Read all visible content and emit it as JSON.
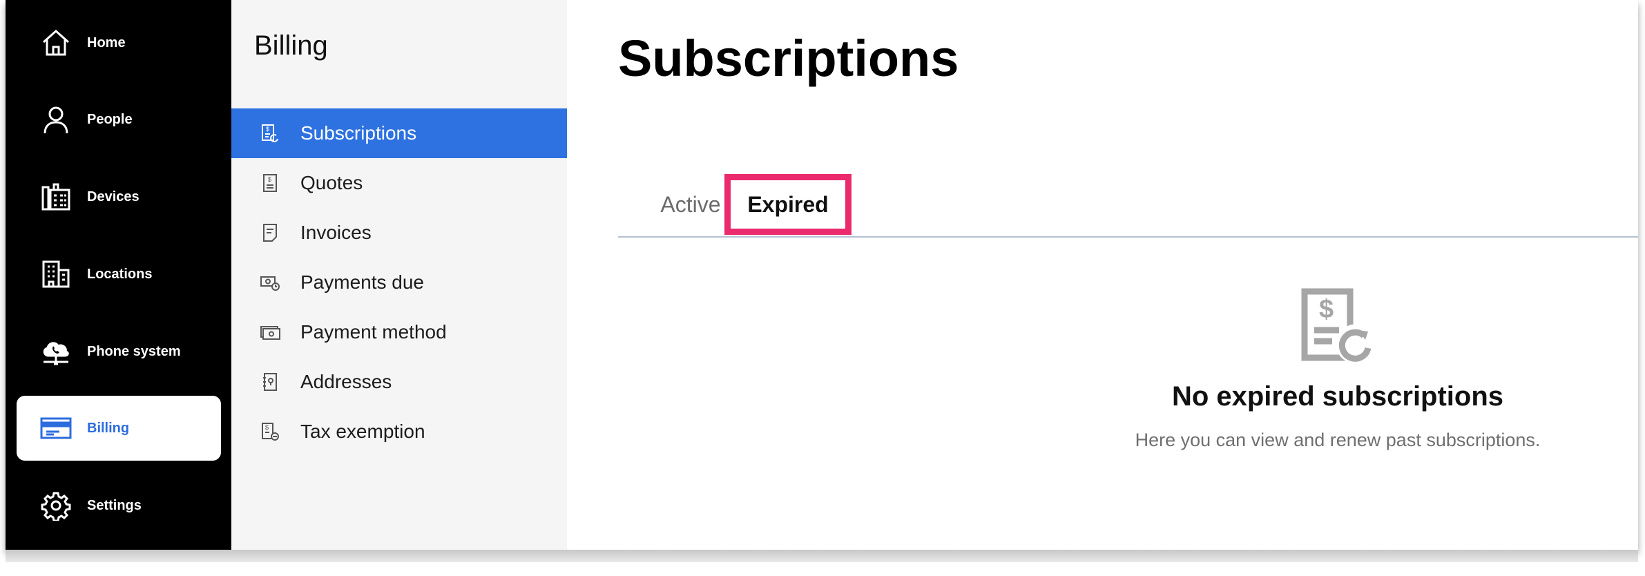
{
  "nav": {
    "items": [
      {
        "label": "Home",
        "icon": "home-icon"
      },
      {
        "label": "People",
        "icon": "person-icon"
      },
      {
        "label": "Devices",
        "icon": "devices-icon"
      },
      {
        "label": "Locations",
        "icon": "building-icon"
      },
      {
        "label": "Phone system",
        "icon": "cloud-phone-icon"
      },
      {
        "label": "Billing",
        "icon": "billing-card-icon",
        "active": true
      },
      {
        "label": "Settings",
        "icon": "gear-icon"
      }
    ]
  },
  "billing_menu": {
    "title": "Billing",
    "items": [
      {
        "label": "Subscriptions",
        "icon": "subscription-icon",
        "active": true
      },
      {
        "label": "Quotes",
        "icon": "quote-icon"
      },
      {
        "label": "Invoices",
        "icon": "invoice-icon"
      },
      {
        "label": "Payments due",
        "icon": "payment-due-icon"
      },
      {
        "label": "Payment method",
        "icon": "payment-method-icon"
      },
      {
        "label": "Addresses",
        "icon": "address-book-icon"
      },
      {
        "label": "Tax exemption",
        "icon": "tax-exemption-icon"
      }
    ]
  },
  "main": {
    "title": "Subscriptions",
    "tabs": [
      {
        "label": "Active",
        "active": false
      },
      {
        "label": "Expired",
        "active": true
      }
    ],
    "empty_state": {
      "icon": "subscription-renew-icon",
      "title": "No expired subscriptions",
      "description": "Here you can view and renew past subscriptions."
    }
  },
  "colors": {
    "accent": "#2d72e0",
    "highlight": "#ea2a6d",
    "nav_bg": "#000000",
    "submenu_bg": "#f5f5f5"
  }
}
